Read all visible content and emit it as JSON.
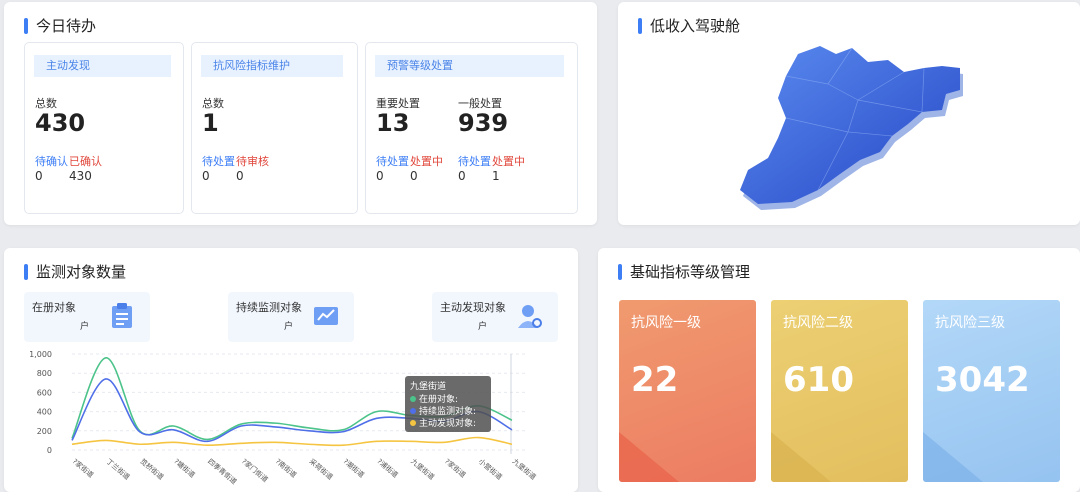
{
  "todo": {
    "title": "今日待办",
    "cards": [
      {
        "head": "主动发现",
        "total_label": "总数",
        "total": "430",
        "sub1_label": "待确认",
        "sub2_label": "已确认",
        "sub1_value": "0",
        "sub2_value": "430"
      },
      {
        "head": "抗风险指标维护",
        "total_label": "总数",
        "total": "1",
        "sub1_label": "待处置",
        "sub2_label": "待审核",
        "sub1_value": "0",
        "sub2_value": "0"
      },
      {
        "head": "预警等级处置",
        "left_label": "重要处置",
        "left_total": "13",
        "right_label": "一般处置",
        "right_total": "939",
        "l_sub1_label": "待处置",
        "l_sub2_label": "处置中",
        "l_sub1_value": "0",
        "l_sub2_value": "0",
        "r_sub1_label": "待处置",
        "r_sub2_label": "处置中",
        "r_sub1_value": "0",
        "r_sub2_value": "1"
      }
    ]
  },
  "low_income": {
    "title": "低收入驾驶舱"
  },
  "monitor": {
    "title": "监测对象数量",
    "stats": [
      {
        "label": "在册对象",
        "unit": "户",
        "icon": "clipboard-icon"
      },
      {
        "label": "持续监测对象",
        "unit": "户",
        "icon": "trend-chart-icon"
      },
      {
        "label": "主动发现对象",
        "unit": "户",
        "icon": "user-search-icon"
      }
    ],
    "tooltip": {
      "title": "九堡街道",
      "items": [
        "在册对象:",
        "持续监测对象:",
        "主动发现对象:"
      ]
    }
  },
  "base": {
    "title": "基础指标等级管理",
    "levels": [
      {
        "name": "抗风险一级",
        "value": "22"
      },
      {
        "name": "抗风险二级",
        "value": "610"
      },
      {
        "name": "抗风险三级",
        "value": "3042"
      }
    ]
  },
  "colors": {
    "accent": "#3d7ef5",
    "series_registered": "#4cc38a",
    "series_monitoring": "#4f6fe8",
    "series_discovered": "#f5c542",
    "level1": "#ee7d5f",
    "level2": "#e7c462",
    "level3": "#9cc8f2"
  },
  "chart_data": {
    "type": "line",
    "categories": [
      "?家街道",
      "丁兰街道",
      "笕桥街道",
      "?塘街道",
      "四季青街道",
      "?家门街道",
      "?南街道",
      "采荷街道",
      "?潮街道",
      "?浦街道",
      "九堡街道",
      "?家街道",
      "小营街道",
      "九堡街道"
    ],
    "ylim": [
      0,
      1000
    ],
    "yticks": [
      "0",
      "200",
      "400",
      "600",
      "800",
      "1,000"
    ],
    "series": [
      {
        "name": "在册对象",
        "values": [
          120,
          960,
          200,
          250,
          110,
          270,
          280,
          230,
          210,
          400,
          360,
          350,
          460,
          310
        ]
      },
      {
        "name": "持续监测对象",
        "values": [
          100,
          740,
          190,
          210,
          90,
          250,
          240,
          200,
          190,
          330,
          330,
          300,
          400,
          210
        ]
      },
      {
        "name": "主动发现对象",
        "values": [
          60,
          100,
          60,
          80,
          50,
          70,
          80,
          60,
          50,
          90,
          90,
          80,
          130,
          60
        ]
      }
    ]
  }
}
